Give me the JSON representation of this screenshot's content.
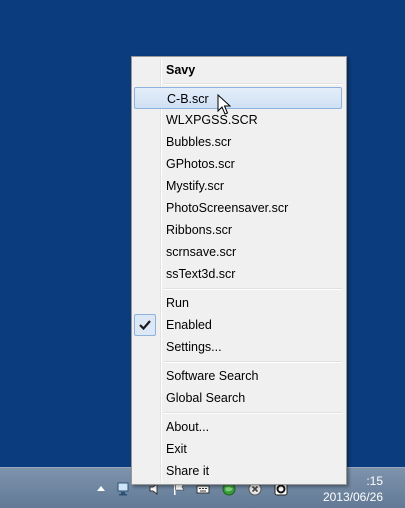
{
  "menu": {
    "title": "Savy",
    "screensavers": [
      {
        "label": "C-B.scr",
        "highlighted": true
      },
      {
        "label": "WLXPGSS.SCR"
      },
      {
        "label": "Bubbles.scr"
      },
      {
        "label": "GPhotos.scr"
      },
      {
        "label": "Mystify.scr"
      },
      {
        "label": "PhotoScreensaver.scr"
      },
      {
        "label": "Ribbons.scr"
      },
      {
        "label": "scrnsave.scr"
      },
      {
        "label": "ssText3d.scr"
      }
    ],
    "run_label": "Run",
    "enabled_label": "Enabled",
    "enabled_checked": true,
    "settings_label": "Settings...",
    "software_search_label": "Software Search",
    "global_search_label": "Global Search",
    "about_label": "About...",
    "exit_label": "Exit",
    "share_label": "Share it"
  },
  "taskbar": {
    "time": ":15",
    "date": "2013/06/26"
  },
  "colors": {
    "desktop": "#0b3c7d",
    "menu_bg": "#f0f0f0",
    "highlight": "#cfe0f4",
    "highlight_border": "#8fb2dc"
  }
}
